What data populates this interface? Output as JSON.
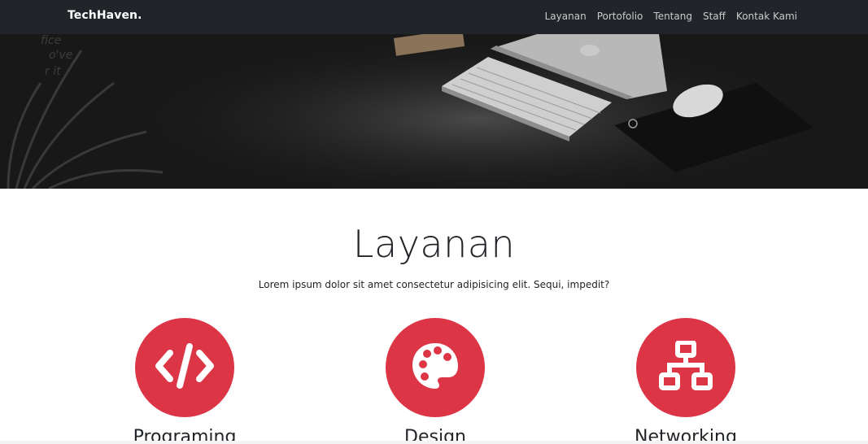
{
  "navbar": {
    "brand": "TechHaven.",
    "links": [
      "Layanan",
      "Portofolio",
      "Tentang",
      "Staff",
      "Kontak Kami"
    ]
  },
  "hero": {
    "image": "desk-with-keyboard-laptop-mouse-plant"
  },
  "services": {
    "title": "Layanan",
    "subtitle": "Lorem ipsum dolor sit amet consectetur adipisicing elit. Sequi, impedit?",
    "items": [
      {
        "title": "Programing",
        "icon": "code-icon"
      },
      {
        "title": "Design",
        "icon": "palette-icon"
      },
      {
        "title": "Networking",
        "icon": "network-icon"
      }
    ]
  },
  "colors": {
    "navbar": "#212529",
    "accent": "#dc3545",
    "text": "#212529"
  }
}
